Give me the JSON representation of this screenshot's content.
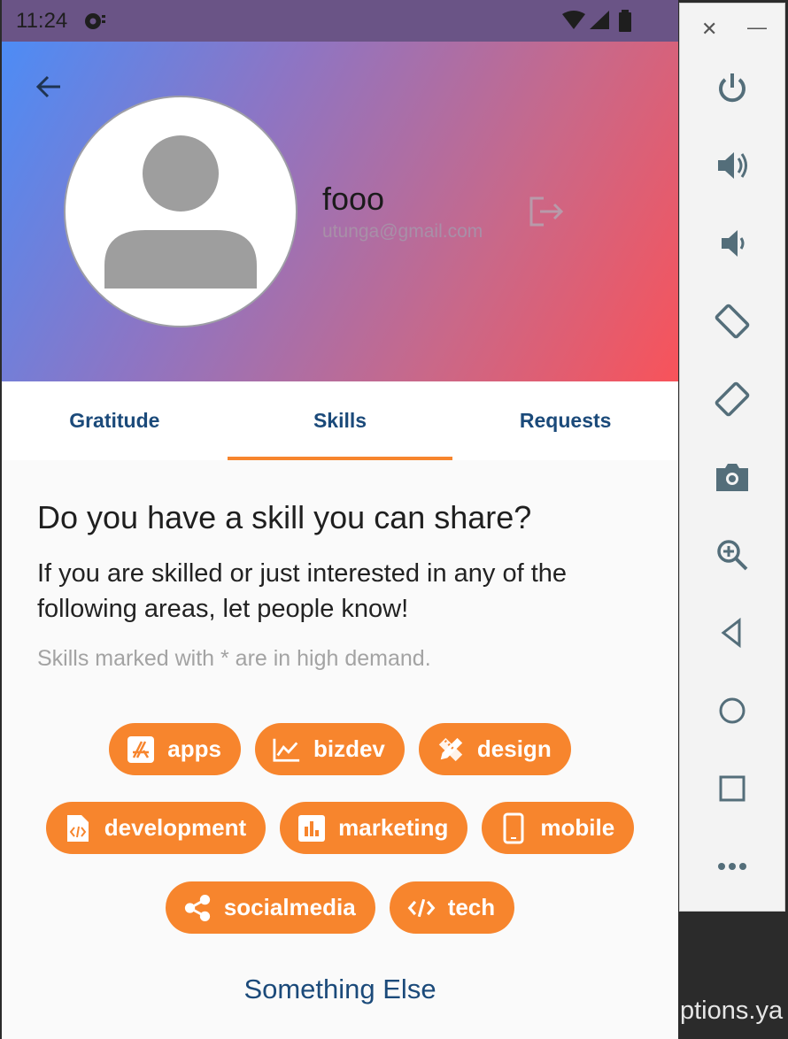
{
  "status_bar": {
    "time": "11:24"
  },
  "profile": {
    "name": "fooo",
    "email": "utunga@gmail.com"
  },
  "tabs": [
    {
      "label": "Gratitude"
    },
    {
      "label": "Skills"
    },
    {
      "label": "Requests"
    }
  ],
  "active_tab": "Skills",
  "skills_page": {
    "heading": "Do you have a skill you can share?",
    "intro": "If you are skilled or just interested in any of the following areas, let people know!",
    "note": "Skills marked with * are in high demand.",
    "chips": [
      {
        "label": "apps",
        "icon": "app-store-icon"
      },
      {
        "label": "bizdev",
        "icon": "chart-line-icon"
      },
      {
        "label": "design",
        "icon": "pencil-ruler-icon"
      },
      {
        "label": "development",
        "icon": "code-file-icon"
      },
      {
        "label": "marketing",
        "icon": "bar-chart-icon"
      },
      {
        "label": "mobile",
        "icon": "mobile-phone-icon"
      },
      {
        "label": "socialmedia",
        "icon": "share-icon"
      },
      {
        "label": "tech",
        "icon": "code-icon"
      }
    ],
    "something_else": "Something Else"
  },
  "emulator_panel": {
    "buttons": [
      "power",
      "volume-up",
      "volume-down",
      "rotate-left",
      "rotate-right",
      "camera",
      "zoom",
      "back",
      "home",
      "overview",
      "more"
    ]
  },
  "background_text": "ptions.ya",
  "colors": {
    "accent": "#f7852d",
    "tab_text": "#1b4a7a",
    "gradient_start": "#4d8cf5",
    "gradient_end": "#f8535a"
  }
}
